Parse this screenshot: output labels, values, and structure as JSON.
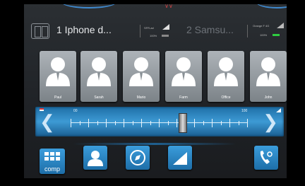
{
  "top": {
    "marker_icon": "sound-wave-icon"
  },
  "phones": [
    {
      "name": "1 Iphone d...",
      "carrier": "SFR-ad",
      "battery": "100%",
      "active": true
    },
    {
      "name": "2 Samsu...",
      "carrier": "Orange F 4G",
      "battery": "100%",
      "active": false
    }
  ],
  "contacts": [
    {
      "name": "Paul"
    },
    {
      "name": "Sarah"
    },
    {
      "name": "Mario"
    },
    {
      "name": "Farm"
    },
    {
      "name": "Office"
    },
    {
      "name": "John"
    }
  ],
  "slider": {
    "min_label": "00",
    "max_label": "100",
    "value_fraction": 0.63
  },
  "bottom": {
    "comp_label": "comp",
    "buttons": [
      "keypad-icon",
      "contact-icon",
      "compass-icon",
      "signal-icon",
      "call-transfer-icon"
    ]
  },
  "colors": {
    "accent": "#3d9ad4",
    "button": "#2a86c5",
    "battery_green": "#2ecc40"
  }
}
